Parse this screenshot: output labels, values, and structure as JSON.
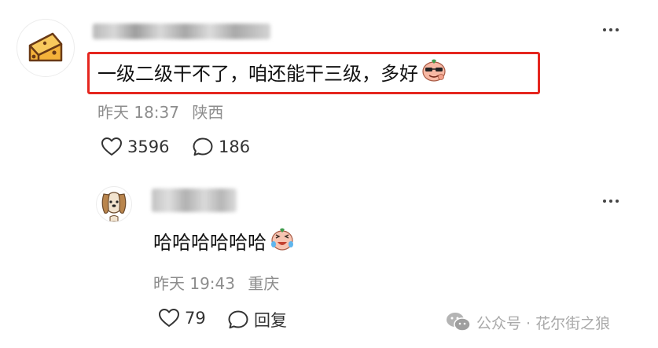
{
  "main_comment": {
    "text": "一级二级干不了，咱还能干三级，多好",
    "emoji": "sunglasses-face-emoji",
    "time": "昨天 18:37",
    "location": "陕西",
    "likes": "3596",
    "replies": "186"
  },
  "reply_comment": {
    "text": "哈哈哈哈哈哈",
    "emoji": "laughing-tears-face-emoji",
    "time": "昨天 19:43",
    "location": "重庆",
    "likes": "79",
    "reply_label": "回复"
  },
  "watermark": {
    "text": "公众号 · 花尔街之狼"
  },
  "colors": {
    "highlight": "#e5261f",
    "meta_text": "#8d8d8d",
    "cheese": "#f4b23a"
  }
}
